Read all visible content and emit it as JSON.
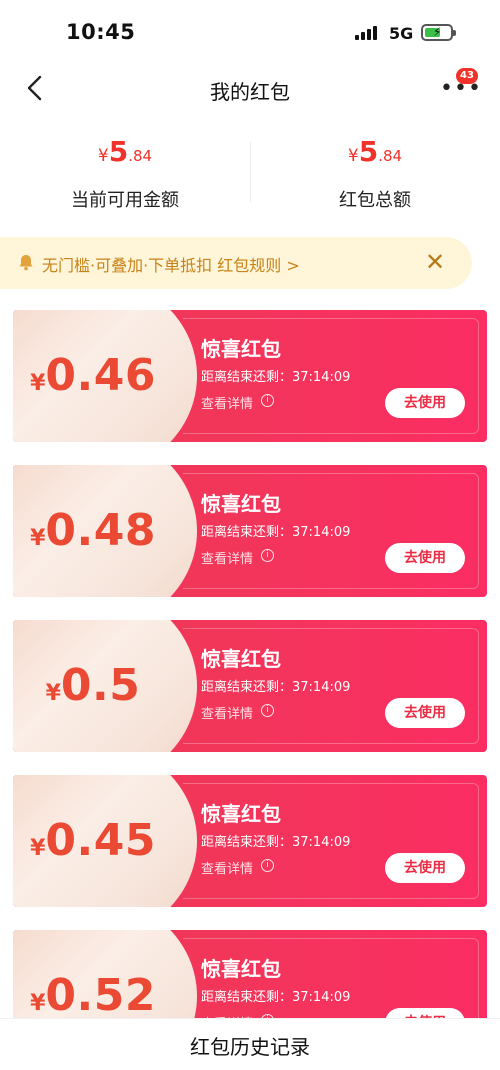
{
  "status_bar": {
    "time": "10:45",
    "network": "5G"
  },
  "nav": {
    "title": "我的红包",
    "more_icon": "more-dots-icon",
    "badge_count": "43"
  },
  "summary": {
    "available": {
      "currency": "¥",
      "int": "5",
      "dec": ".84",
      "label": "当前可用金额"
    },
    "total": {
      "currency": "¥",
      "int": "5",
      "dec": ".84",
      "label": "红包总额"
    }
  },
  "notice": {
    "text": "无门槛·可叠加·下单抵扣 红包规则 >",
    "close": "✕"
  },
  "coupons": [
    {
      "currency": "¥",
      "amount": "0.46",
      "title": "惊喜红包",
      "countdown": "距离结束还剩：37:14:09",
      "details": "查看详情",
      "button": "去使用"
    },
    {
      "currency": "¥",
      "amount": "0.48",
      "title": "惊喜红包",
      "countdown": "距离结束还剩：37:14:09",
      "details": "查看详情",
      "button": "去使用"
    },
    {
      "currency": "¥",
      "amount": "0.5",
      "title": "惊喜红包",
      "countdown": "距离结束还剩：37:14:09",
      "details": "查看详情",
      "button": "去使用"
    },
    {
      "currency": "¥",
      "amount": "0.45",
      "title": "惊喜红包",
      "countdown": "距离结束还剩：37:14:09",
      "details": "查看详情",
      "button": "去使用"
    },
    {
      "currency": "¥",
      "amount": "0.52",
      "title": "惊喜红包",
      "countdown": "距离结束还剩：37:14:09",
      "details": "查看详情",
      "button": "去使用"
    }
  ],
  "bottom": {
    "history_label": "红包历史记录"
  },
  "colors": {
    "accent": "#f0322a",
    "coupon_red": "#f2365a",
    "notice_bg": "#fff5d9",
    "notice_text": "#c88318"
  }
}
